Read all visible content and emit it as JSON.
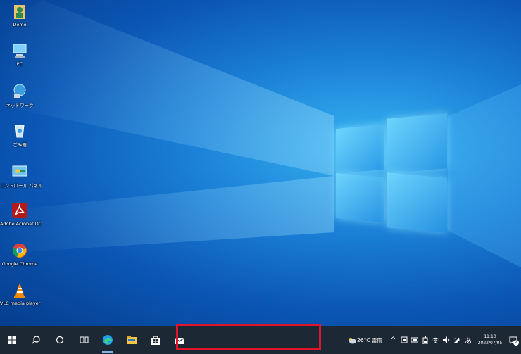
{
  "desktop_icons": [
    {
      "label": "Demo",
      "icon": "user-folder-icon"
    },
    {
      "label": "PC",
      "icon": "computer-icon"
    },
    {
      "label": "ネットワーク",
      "icon": "network-icon"
    },
    {
      "label": "ごみ箱",
      "icon": "recycle-bin-icon"
    },
    {
      "label": "コントロール パネル",
      "icon": "control-panel-icon"
    },
    {
      "label": "Adobe Acrobat DC",
      "icon": "adobe-acrobat-icon"
    },
    {
      "label": "Google Chrome",
      "icon": "chrome-icon"
    },
    {
      "label": "VLC media player",
      "icon": "vlc-icon"
    }
  ],
  "taskbar": {
    "weather": "26°C 雷雨",
    "ime": "あ",
    "time": "11:10",
    "date": "2022/07/05",
    "notification_count": "2"
  },
  "colors": {
    "taskbar": "#1d2835",
    "highlight": "#e0142a"
  }
}
